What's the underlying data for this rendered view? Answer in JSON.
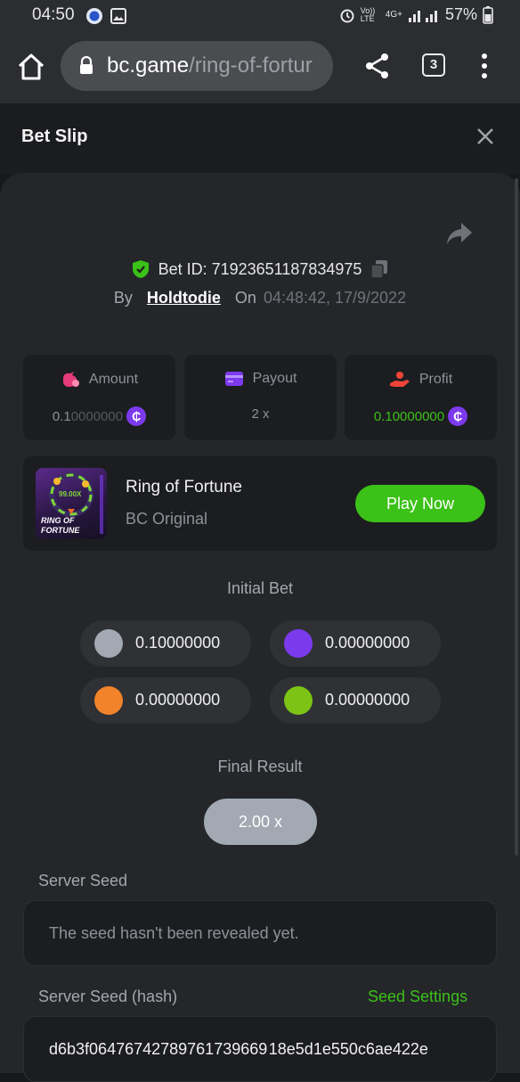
{
  "status_bar": {
    "time": "04:50",
    "network_label": "Vo)) LTE",
    "signal_label": "4G+",
    "battery": "57%"
  },
  "browser": {
    "url_host": "bc.game",
    "url_path": "/ring-of-fortur",
    "tab_count": "3"
  },
  "bet_slip": {
    "title": "Bet Slip",
    "bet_id_label": "Bet ID: 71923651187834975",
    "by_label": "By",
    "username": "Holdtodie",
    "on_label": "On",
    "datetime": "04:48:42, 17/9/2022",
    "stats": [
      {
        "label": "Amount",
        "value_main": "0.1",
        "value_dim": "0000000",
        "main_color": "#8e9298",
        "coin": "₵"
      },
      {
        "label": "Payout",
        "value_main": "2 x",
        "value_dim": "",
        "main_color": "#8e9298",
        "coin": ""
      },
      {
        "label": "Profit",
        "value_main": "0.1",
        "value_dim": "0000000",
        "main_color": "#3bc117",
        "coin": "₵"
      }
    ],
    "game": {
      "name": "Ring of Fortune",
      "provider": "BC Original",
      "play_label": "Play Now",
      "thumb_multiplier": "99.00X",
      "thumb_title_1": "RING OF",
      "thumb_title_2": "FORTUNE"
    },
    "initial_bet_label": "Initial Bet",
    "initial_bets": [
      {
        "color": "#a2a9b2",
        "value": "0.10000000"
      },
      {
        "color": "#7c3aed",
        "value": "0.00000000"
      },
      {
        "color": "#f3832a",
        "value": "0.00000000"
      },
      {
        "color": "#7dc316",
        "value": "0.00000000"
      }
    ],
    "final_result_label": "Final Result",
    "final_result": "2.00 x",
    "server_seed_label": "Server Seed",
    "server_seed_value": "The seed hasn't been revealed yet.",
    "server_seed_hash_label": "Server Seed (hash)",
    "seed_settings_label": "Seed Settings",
    "server_seed_hash_value": "d6b3f06476742789761739669 18e5d1e550c6ae422e"
  },
  "colors": {
    "accent_green": "#3bc117",
    "coin_purple": "#7c3aed",
    "panel": "#24262a"
  }
}
